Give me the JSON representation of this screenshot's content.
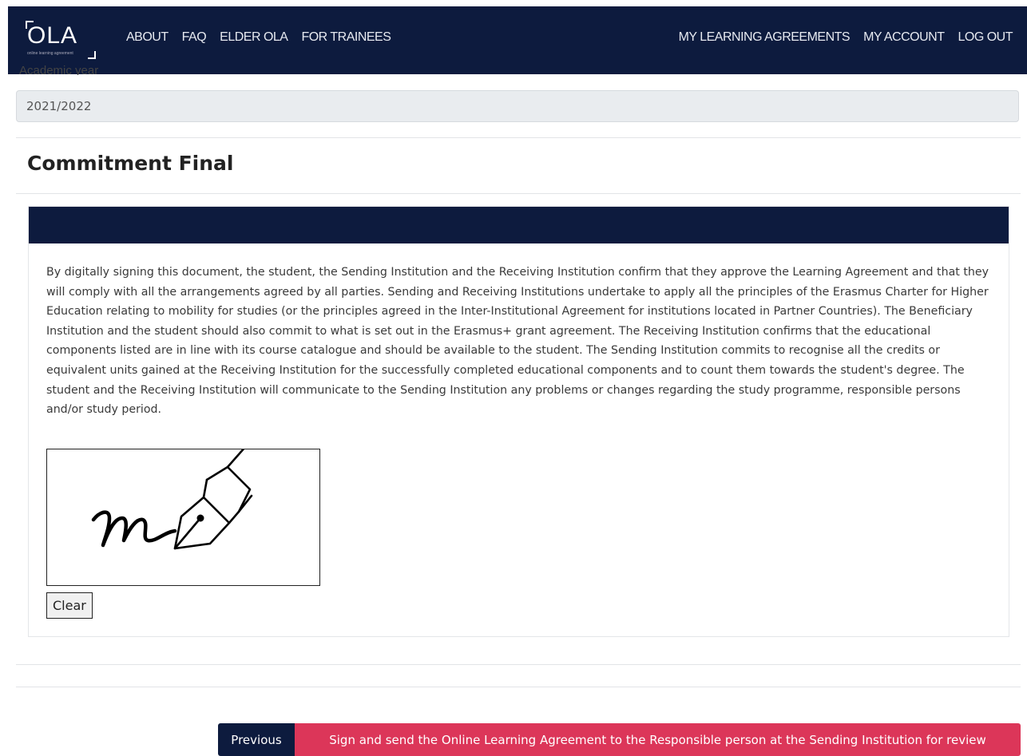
{
  "header": {
    "logo_text": "OLA",
    "logo_subtext": "online learning agreement",
    "nav_left": [
      "ABOUT",
      "FAQ",
      "ELDER OLA",
      "FOR TRAINEES"
    ],
    "nav_right": [
      "MY LEARNING AGREEMENTS",
      "MY ACCOUNT",
      "LOG OUT"
    ]
  },
  "academic_year": {
    "label": "Academic year",
    "value": "2021/2022"
  },
  "section": {
    "title": "Commitment Final"
  },
  "commitment": {
    "text": "By digitally signing this document, the student, the Sending Institution and the Receiving Institution confirm that they approve the Learning Agreement and that they will comply with all the arrangements agreed by all parties. Sending and Receiving Institutions undertake to apply all the principles of the Erasmus Charter for Higher Education relating to mobility for studies (or the principles agreed in the Inter-Institutional Agreement for institutions located in Partner Countries). The Beneficiary Institution and the student should also commit to what is set out in the Erasmus+ grant agreement. The Receiving Institution confirms that the educational components listed are in line with its course catalogue and should be available to the student. The Sending Institution commits to recognise all the credits or equivalent units gained at the Receiving Institution for the successfully completed educational components and to count them towards the student's degree. The student and the Receiving Institution will communicate to the Sending Institution any problems or changes regarding the study programme, responsible persons and/or study period.",
    "clear_label": "Clear"
  },
  "actions": {
    "previous_label": "Previous",
    "sign_label": "Sign and send the Online Learning Agreement to the Responsible person at the Sending Institution for review"
  },
  "colors": {
    "navy": "#0d1b3e",
    "accent_red": "#dc3659",
    "field_bg": "#e9ecef"
  }
}
